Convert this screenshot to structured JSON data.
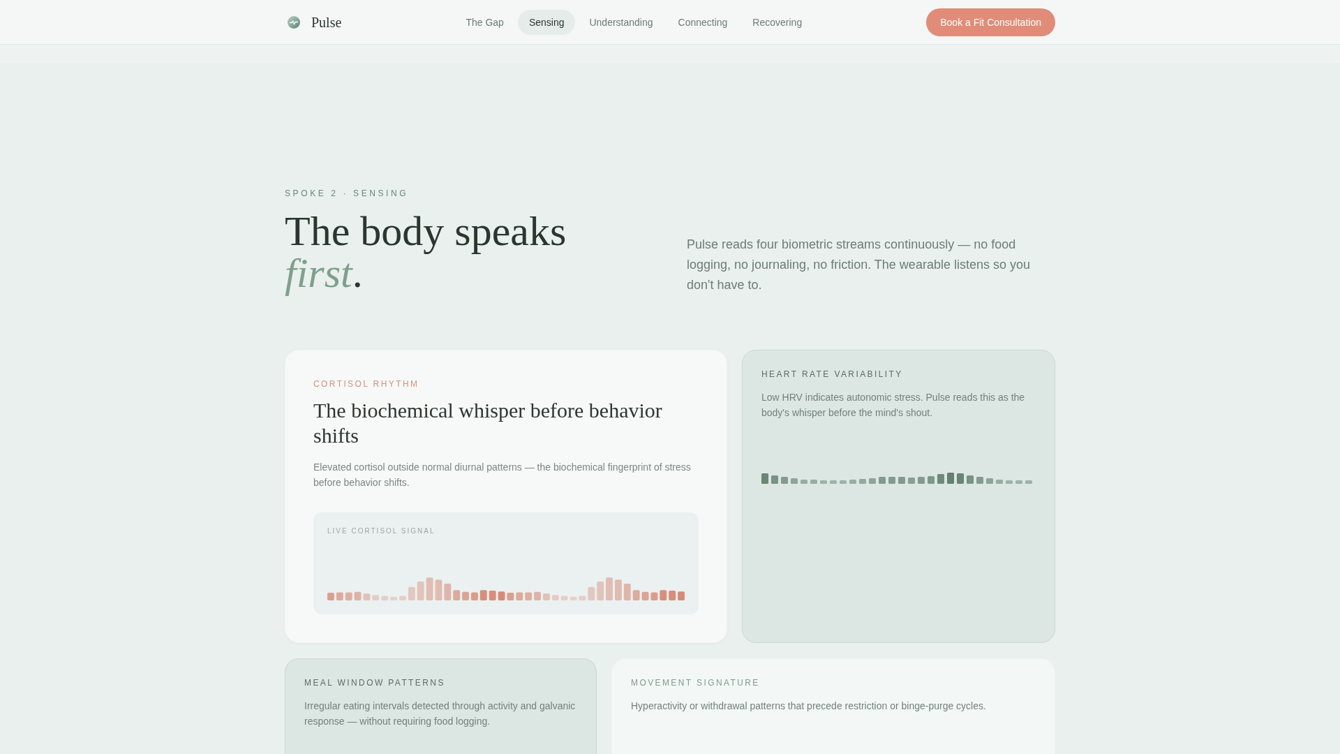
{
  "nav": {
    "brand": "Pulse",
    "links": [
      {
        "label": "The Gap",
        "selected": false
      },
      {
        "label": "Sensing",
        "selected": true
      },
      {
        "label": "Understanding",
        "selected": false
      },
      {
        "label": "Connecting",
        "selected": false
      },
      {
        "label": "Recovering",
        "selected": false
      }
    ],
    "cta": "Book a Fit Consultation"
  },
  "hero": {
    "eyebrow": "SPOKE 2 · SENSING",
    "title_lines": [
      "The body speaks",
      "*first*."
    ],
    "lead": "Pulse reads four biometric streams continuously — no food logging, no journaling, no friction. The wearable listens so you don't have to."
  },
  "cards": [
    {
      "kind": "feature",
      "label": "CORTISOL RHYTHM",
      "title": "The biochemical whisper before behavior shifts",
      "text": "Elevated cortisol outside normal diurnal patterns — the biochemical fingerprint of stress before behavior shifts.",
      "panel_label": "LIVE CORTISOL SIGNAL"
    },
    {
      "kind": "signal",
      "label": "HEART RATE VARIABILITY",
      "text": "Low HRV indicates autonomic stress. Pulse reads this as the body's whisper before the mind's shout."
    },
    {
      "kind": "tinted",
      "label": "MEAL WINDOW PATTERNS",
      "text": "Irregular eating intervals detected through activity and galvanic response — without requiring food logging."
    },
    {
      "kind": "light",
      "label": "MOVEMENT SIGNATURE",
      "text": "Hyperactivity or withdrawal patterns that precede restriction or binge-purge cycles."
    }
  ]
}
